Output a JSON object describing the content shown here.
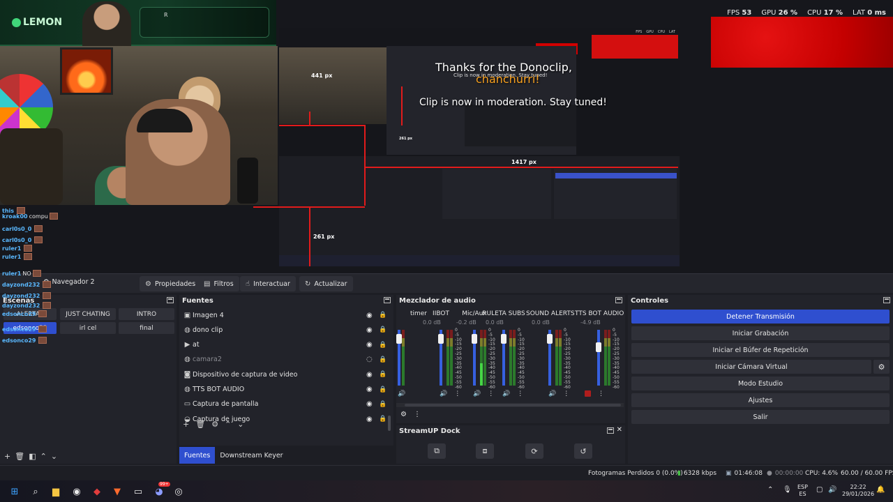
{
  "stats": {
    "fps_label": "FPS",
    "fps_value": "53",
    "gpu_label": "GPU",
    "gpu_value": "26 %",
    "cpu_label": "CPU",
    "cpu_value": "17 %",
    "lat_label": "LAT",
    "lat_value": "0 ms"
  },
  "overlay": {
    "brand": "LEMON",
    "box_label": "R",
    "clip_line1": "Thanks for the Donoclip,",
    "clip_name": "chanchurri!",
    "clip_line2": "Clip is now in moderation. Stay tuned!",
    "mini_line": "Clip is now in moderation. Stay tuned!",
    "dim_441": "441 px",
    "dim_1417": "1417 px",
    "dim_261": "261 px"
  },
  "chat": [
    {
      "name": "this",
      "text": ""
    },
    {
      "name": "kroak00",
      "text": "compu"
    },
    {
      "name": "carl0s0_0",
      "text": ""
    },
    {
      "name": "carl0s0_0",
      "text": ""
    },
    {
      "name": "ruler1",
      "text": ""
    },
    {
      "name": "ruler1",
      "text": ""
    },
    {
      "name": "ruler1",
      "text": "NO"
    },
    {
      "name": "dayzond232",
      "text": ""
    },
    {
      "name": "dayzond232",
      "text": ""
    },
    {
      "name": "dayzond232",
      "text": ""
    },
    {
      "name": "edsonco29",
      "text": ""
    },
    {
      "name": "edsonco29",
      "text": ""
    },
    {
      "name": "edsonco29",
      "text": ""
    }
  ],
  "toolbar": {
    "scene_name": "Navegador 2",
    "propiedades": "Propiedades",
    "filtros": "Filtros",
    "interactuar": "Interactuar",
    "actualizar": "Actualizar"
  },
  "scenes": {
    "title": "Escenas",
    "items": [
      "ALERTAS",
      "JUST CHATING",
      "INTRO",
      "edsonco29",
      "irl cel",
      "final"
    ]
  },
  "sources": {
    "title": "Fuentes",
    "items": [
      {
        "name": "Imagen 4",
        "icon": "image-icon",
        "hidden": false
      },
      {
        "name": "dono clip",
        "icon": "globe-icon",
        "hidden": false
      },
      {
        "name": "at",
        "icon": "play-icon",
        "hidden": false
      },
      {
        "name": "camara2",
        "icon": "globe-icon",
        "hidden": true
      },
      {
        "name": "Dispositivo de captura de video",
        "icon": "camera-icon",
        "hidden": false
      },
      {
        "name": "TTS BOT AUDIO",
        "icon": "globe-icon",
        "hidden": false
      },
      {
        "name": "Captura de pantalla",
        "icon": "monitor-icon",
        "hidden": false
      },
      {
        "name": "Captura de juego",
        "icon": "gamepad-icon",
        "hidden": false
      }
    ],
    "tab_fuentes": "Fuentes",
    "tab_downstream": "Downstream Keyer"
  },
  "mixer": {
    "title": "Mezclador de audio",
    "channels": [
      {
        "name": "timer",
        "db": ""
      },
      {
        "name": "IIBOT",
        "db": "0.0 dB"
      },
      {
        "name": "Mic/Aux",
        "db": "-0.2 dB"
      },
      {
        "name": "RULETA SUBS",
        "db": "0.0 dB"
      },
      {
        "name": "SOUND ALERTS",
        "db": "0.0 dB"
      },
      {
        "name": "TTS BOT AUDIO",
        "db": "-4.9 dB"
      }
    ],
    "scale": [
      "0",
      "-5",
      "-10",
      "-15",
      "-20",
      "-25",
      "-30",
      "-35",
      "-40",
      "-45",
      "-50",
      "-55",
      "-60"
    ]
  },
  "streamup": {
    "title": "StreamUP Dock"
  },
  "controls": {
    "title": "Controles",
    "stop_stream": "Detener Transmisión",
    "start_record": "Iniciar Grabación",
    "replay_buffer": "Iniciar el Búfer de Repetición",
    "virtual_cam": "Iniciar Cámara Virtual",
    "studio_mode": "Modo Estudio",
    "settings": "Ajustes",
    "exit": "Salir"
  },
  "status": {
    "dropped": "Fotogramas Perdidos 0 (0.0%)",
    "bitrate": "6328 kbps",
    "stream_time": "01:46:08",
    "rec_time": "00:00:00",
    "cpu": "CPU: 4.6%",
    "fps": "60.00 / 60.00 FPS"
  },
  "taskbar": {
    "lang_top": "ESP",
    "lang_bottom": "ES",
    "time": "22:22",
    "date": "29/01/2026",
    "discord_badge": "99+"
  },
  "colors": {
    "accent": "#2f4fcf",
    "panel": "#22232a",
    "background": "#1d1e24",
    "red": "#e21b1b"
  }
}
